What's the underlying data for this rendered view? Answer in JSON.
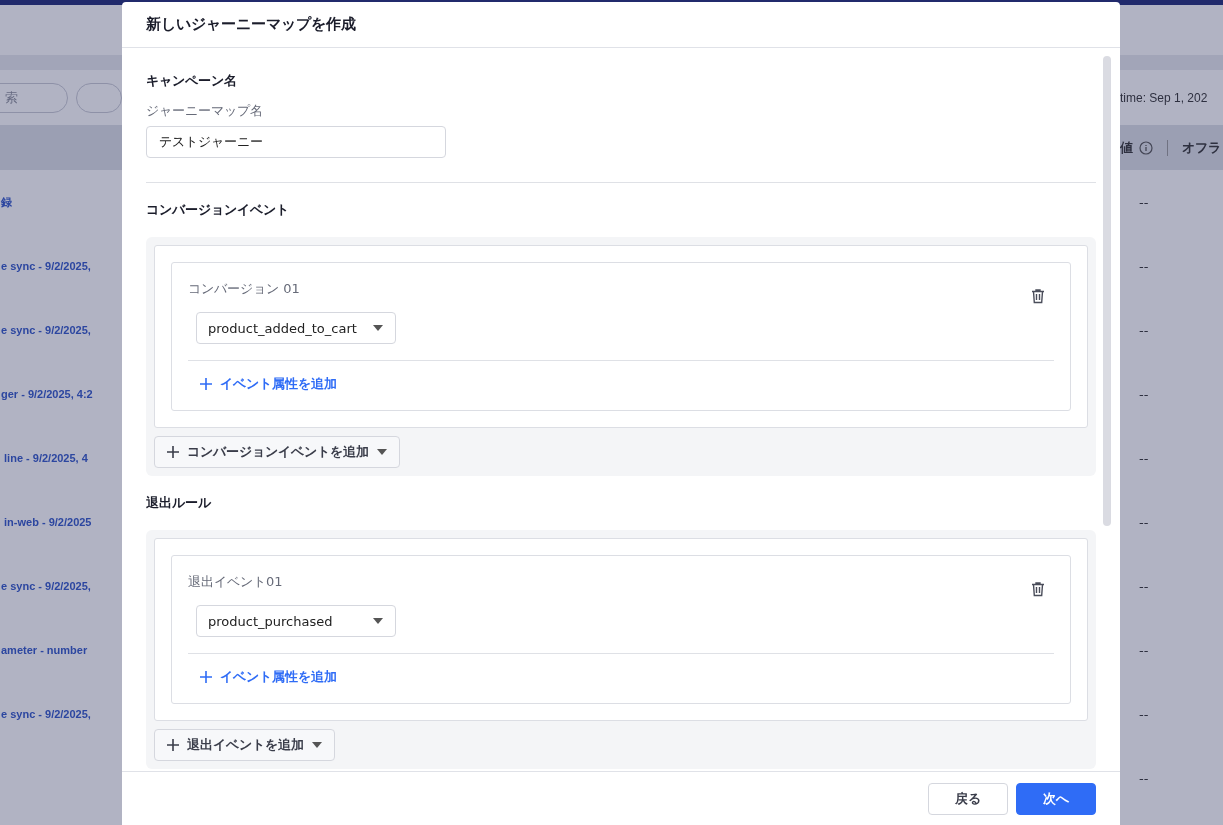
{
  "background": {
    "search_field": {
      "placeholder": "索"
    },
    "filter_text": "time: Sep 1, 202",
    "columns": [
      {
        "label": "値",
        "info": true
      },
      {
        "label": "オフラ",
        "info": false
      }
    ],
    "rows": [
      {
        "name": "録",
        "value": "--"
      },
      {
        "name": "e sync - 9/2/2025,",
        "value": "--"
      },
      {
        "name": "e sync - 9/2/2025,",
        "value": "--"
      },
      {
        "name": "ger - 9/2/2025, 4:2",
        "value": "--"
      },
      {
        "name": " line - 9/2/2025, 4",
        "value": "--"
      },
      {
        "name": " in-web - 9/2/2025",
        "value": "--"
      },
      {
        "name": "e sync - 9/2/2025,",
        "value": "--"
      },
      {
        "name": "ameter - number",
        "value": "--"
      },
      {
        "name": "e sync - 9/2/2025,",
        "value": "--"
      },
      {
        "name": "",
        "value": "--"
      }
    ]
  },
  "dialog": {
    "title": "新しいジャーニーマップを作成",
    "sections": [
      {
        "kind": "name",
        "heading": "キャンペーン名",
        "label": "ジャーニーマップ名",
        "value": "テストジャーニー"
      },
      {
        "kind": "events",
        "heading": "コンバージョンイベント",
        "items": [
          {
            "label": "コンバージョン 01",
            "event": "product_added_to_cart",
            "add_attribute": "イベント属性を追加"
          }
        ],
        "add_button": "コンバージョンイベントを追加"
      },
      {
        "kind": "events",
        "heading": "退出ルール",
        "items": [
          {
            "label": "退出イベント01",
            "event": "product_purchased",
            "add_attribute": "イベント属性を追加"
          }
        ],
        "add_button": "退出イベントを追加"
      }
    ],
    "buttons": [
      {
        "label": "戻る",
        "primary": false
      },
      {
        "label": "次へ",
        "primary": true
      }
    ]
  }
}
